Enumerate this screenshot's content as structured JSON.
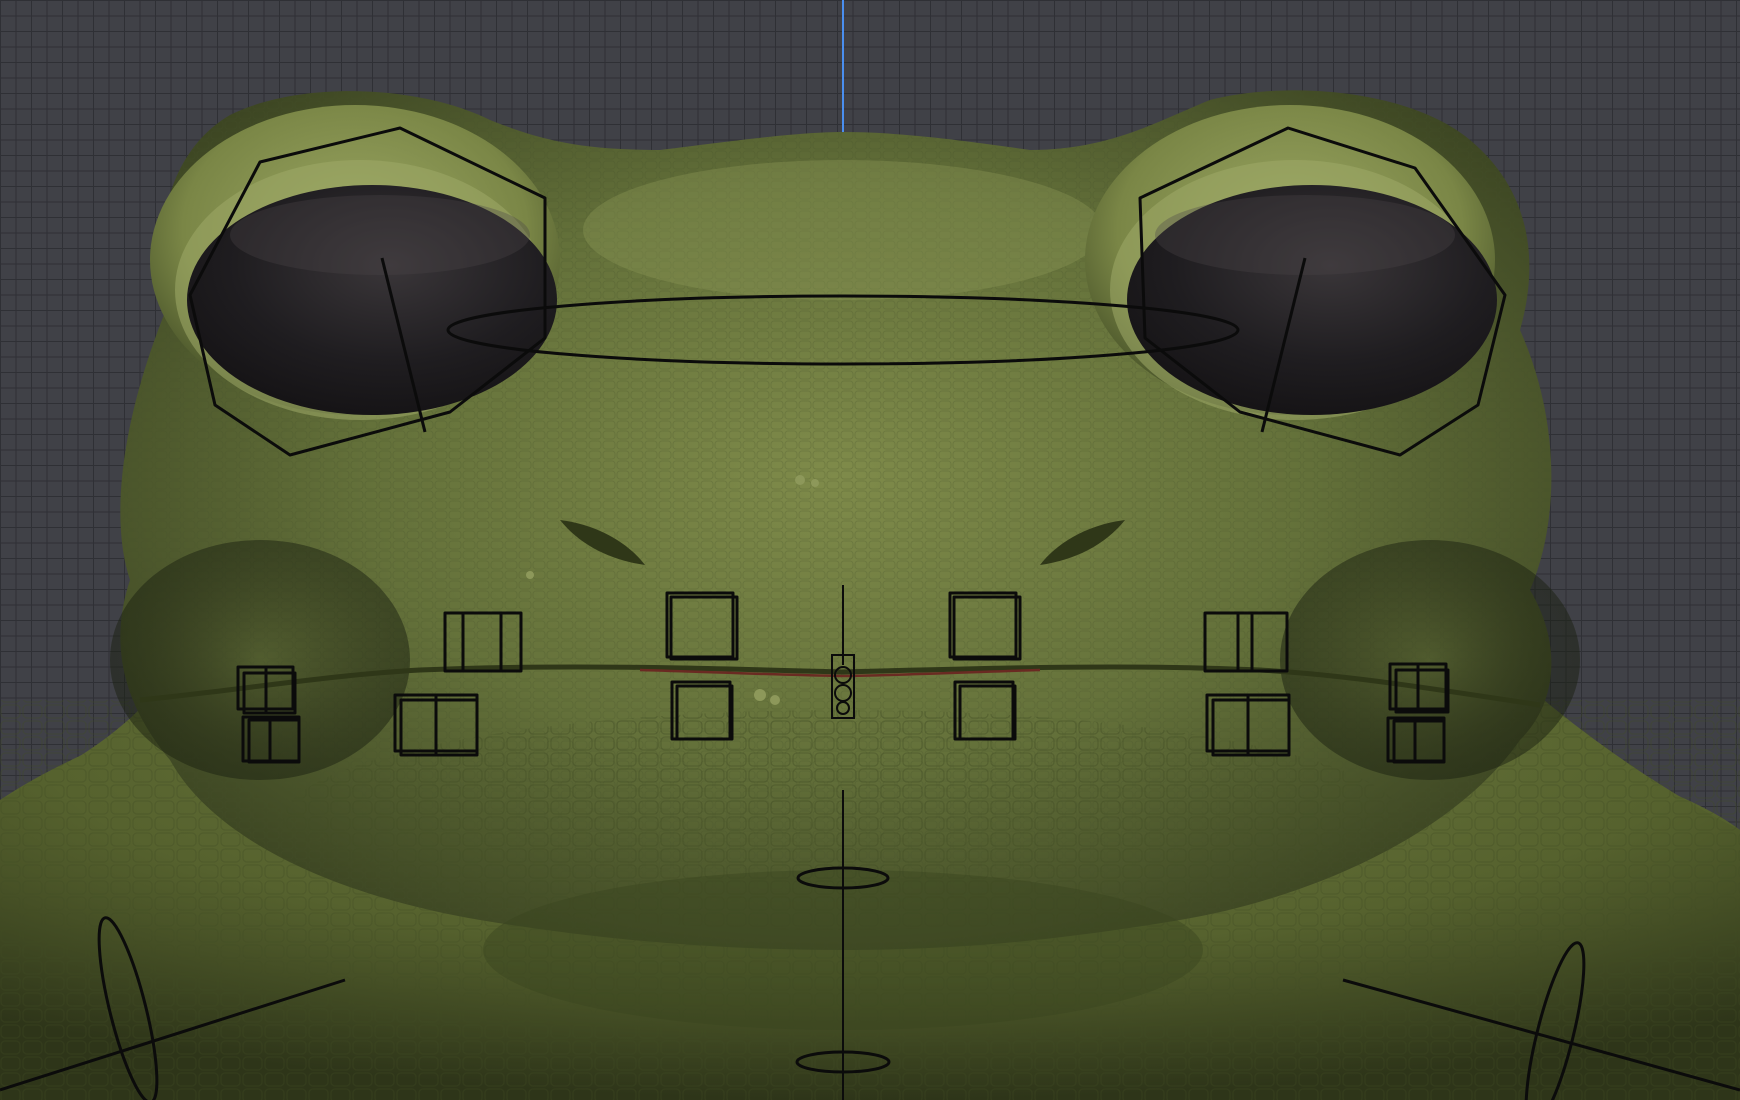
{
  "viewport": {
    "background_color": "#404147",
    "grid_color": "#2f3035",
    "y_axis_color": "#4a8ff0"
  },
  "model": {
    "skin_color": "#5d6b35",
    "skin_highlight": "#8a9656",
    "skin_shadow": "#2c3318",
    "eye_color": "#1e1c1f",
    "mouth_line_color": "#6a2a22"
  },
  "rig": {
    "control_color": "#0b0b0b"
  }
}
